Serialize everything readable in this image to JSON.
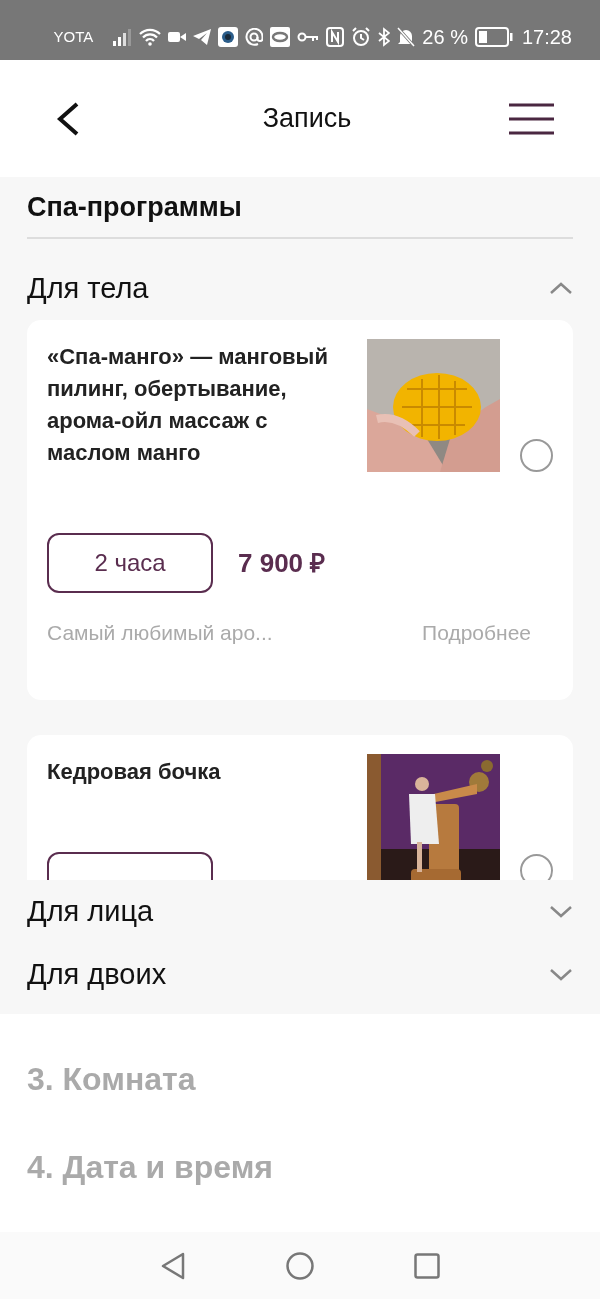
{
  "status_bar": {
    "carrier": "YOTA",
    "battery": "26 %",
    "time": "17:28"
  },
  "header": {
    "title": "Запись"
  },
  "section": {
    "title": "Спа-программы"
  },
  "categories": [
    {
      "title": "Для тела",
      "expanded": true,
      "programs": [
        {
          "title": "«Спа-манго» — манговый пилинг, обертывание, арома-ойл массаж с маслом манго",
          "duration": "2 часа",
          "price": "7 900 ₽",
          "description": "Самый любимый аро...",
          "more": "Подробнее",
          "selected": false
        },
        {
          "title": "Кедровая бочка",
          "selected": false
        }
      ]
    },
    {
      "title": "Для лица",
      "expanded": false
    },
    {
      "title": "Для двоих",
      "expanded": false
    }
  ],
  "steps": [
    {
      "title": "3. Комната"
    },
    {
      "title": "4. Дата и время"
    }
  ]
}
